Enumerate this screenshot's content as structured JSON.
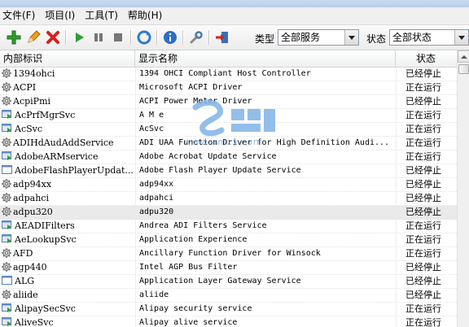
{
  "menu": [
    "文件(F)",
    "项目(I)",
    "工具(T)",
    "帮助(H)"
  ],
  "toolbar": {
    "type_label": "类型",
    "type_value": "全部服务",
    "status_label": "状态",
    "status_value": "全部状态",
    "icons": [
      "add-icon",
      "edit-icon",
      "delete-icon",
      "start-icon",
      "pause-icon",
      "stop-icon",
      "refresh-icon",
      "info-icon",
      "tools-icon",
      "exit-icon"
    ]
  },
  "table": {
    "headers": [
      "内部标识",
      "显示名称",
      "状态"
    ],
    "rows": [
      {
        "id": "1394ohci",
        "name": "1394 OHCI Compliant Host Controller",
        "status": "已经停止",
        "icon": "gear"
      },
      {
        "id": "ACPI",
        "name": "Microsoft ACPI Driver",
        "status": "正在运行",
        "icon": "gear"
      },
      {
        "id": "AcpiPmi",
        "name": "ACPI Power Meter Driver",
        "status": "已经停止",
        "icon": "gear"
      },
      {
        "id": "AcPrfMgrSvc",
        "name": "A  M    e",
        "status": "正在运行",
        "icon": "app"
      },
      {
        "id": "AcSvc",
        "name": "AcSvc",
        "status": "正在运行",
        "icon": "app"
      },
      {
        "id": "ADIHdAudAddService",
        "name": "ADI UAA Function Driver for High Definition Audi...",
        "status": "正在运行",
        "icon": "gear"
      },
      {
        "id": "AdobeARMservice",
        "name": "Adobe Acrobat Update Service",
        "status": "正在运行",
        "icon": "app"
      },
      {
        "id": "AdobeFlashPlayerUpdat...",
        "name": "Adobe Flash Player Update Service",
        "status": "已经停止",
        "icon": "window"
      },
      {
        "id": "adp94xx",
        "name": "adp94xx",
        "status": "已经停止",
        "icon": "gear"
      },
      {
        "id": "adpahci",
        "name": "adpahci",
        "status": "已经停止",
        "icon": "gear"
      },
      {
        "id": "adpu320",
        "name": "adpu320",
        "status": "已经停止",
        "icon": "gear"
      },
      {
        "id": "AEADIFilters",
        "name": "Andrea ADI Filters Service",
        "status": "正在运行",
        "icon": "app"
      },
      {
        "id": "AeLookupSvc",
        "name": "Application Experience",
        "status": "正在运行",
        "icon": "app"
      },
      {
        "id": "AFD",
        "name": "Ancillary Function Driver for Winsock",
        "status": "正在运行",
        "icon": "gear"
      },
      {
        "id": "agp440",
        "name": "Intel AGP Bus Filter",
        "status": "已经停止",
        "icon": "gear"
      },
      {
        "id": "ALG",
        "name": "Application Layer Gateway Service",
        "status": "已经停止",
        "icon": "window"
      },
      {
        "id": "aliide",
        "name": "aliide",
        "status": "已经停止",
        "icon": "gear"
      },
      {
        "id": "AlipaySecSvc",
        "name": "Alipay security service",
        "status": "正在运行",
        "icon": "app"
      },
      {
        "id": "AliveSvc",
        "name": "Alipay alive service",
        "status": "正在运行",
        "icon": "app"
      }
    ]
  },
  "watermark": "www.amzy.com",
  "colors": {
    "accent": "#3a7fc6",
    "running_icon": "#3b9a3b"
  }
}
